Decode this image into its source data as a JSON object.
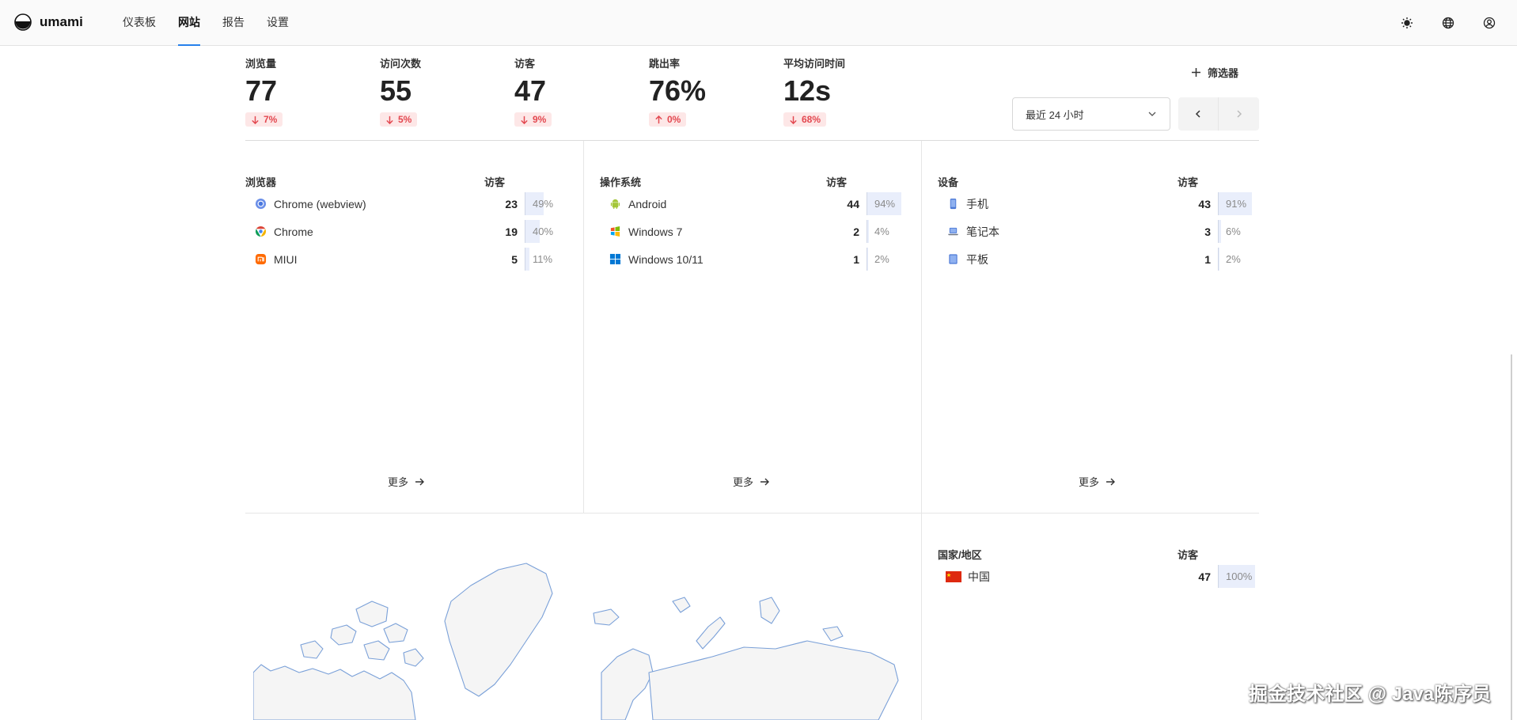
{
  "app": {
    "name": "umami"
  },
  "nav": {
    "items": [
      "仪表板",
      "网站",
      "报告",
      "设置"
    ],
    "active": "网站"
  },
  "header_icons": [
    "sun-icon",
    "globe-icon",
    "user-icon"
  ],
  "metrics": [
    {
      "label": "浏览量",
      "value": "77",
      "change": "7%",
      "direction": "down"
    },
    {
      "label": "访问次数",
      "value": "55",
      "change": "5%",
      "direction": "down"
    },
    {
      "label": "访客",
      "value": "47",
      "change": "9%",
      "direction": "down"
    },
    {
      "label": "跳出率",
      "value": "76%",
      "change": "0%",
      "direction": "up"
    },
    {
      "label": "平均访问时间",
      "value": "12s",
      "change": "68%",
      "direction": "down"
    }
  ],
  "toolbar": {
    "filter_label": "筛选器",
    "date_range": "最近 24 小时"
  },
  "panels": {
    "browsers": {
      "title": "浏览器",
      "col": "访客",
      "rows": [
        {
          "label": "Chrome (webview)",
          "count": "23",
          "percent": "49%",
          "fraction": 0.49,
          "icon": "chrome-webview-icon"
        },
        {
          "label": "Chrome",
          "count": "19",
          "percent": "40%",
          "fraction": 0.4,
          "icon": "chrome-icon"
        },
        {
          "label": "MIUI",
          "count": "5",
          "percent": "11%",
          "fraction": 0.11,
          "icon": "miui-icon"
        }
      ],
      "more": "更多"
    },
    "os": {
      "title": "操作系统",
      "col": "访客",
      "rows": [
        {
          "label": "Android",
          "count": "44",
          "percent": "94%",
          "fraction": 0.94,
          "icon": "android-icon"
        },
        {
          "label": "Windows 7",
          "count": "2",
          "percent": "4%",
          "fraction": 0.04,
          "icon": "windows7-icon"
        },
        {
          "label": "Windows 10/11",
          "count": "1",
          "percent": "2%",
          "fraction": 0.02,
          "icon": "windows11-icon"
        }
      ],
      "more": "更多"
    },
    "devices": {
      "title": "设备",
      "col": "访客",
      "rows": [
        {
          "label": "手机",
          "count": "43",
          "percent": "91%",
          "fraction": 0.91,
          "icon": "phone-icon"
        },
        {
          "label": "笔记本",
          "count": "3",
          "percent": "6%",
          "fraction": 0.06,
          "icon": "laptop-icon"
        },
        {
          "label": "平板",
          "count": "1",
          "percent": "2%",
          "fraction": 0.02,
          "icon": "tablet-icon"
        }
      ],
      "more": "更多"
    },
    "countries": {
      "title": "国家/地区",
      "col": "访客",
      "rows": [
        {
          "label": "中国",
          "count": "47",
          "percent": "100%",
          "fraction": 1.0,
          "icon": "china-flag-icon"
        }
      ]
    }
  },
  "colors": {
    "accent": "#2680eb",
    "negative": "#e34850",
    "negative_bg": "#fde7e7",
    "bar_fill": "#e9eefb",
    "map_stroke": "#7aa0d8"
  },
  "watermark": "掘金技术社区 @ Java陈序员"
}
